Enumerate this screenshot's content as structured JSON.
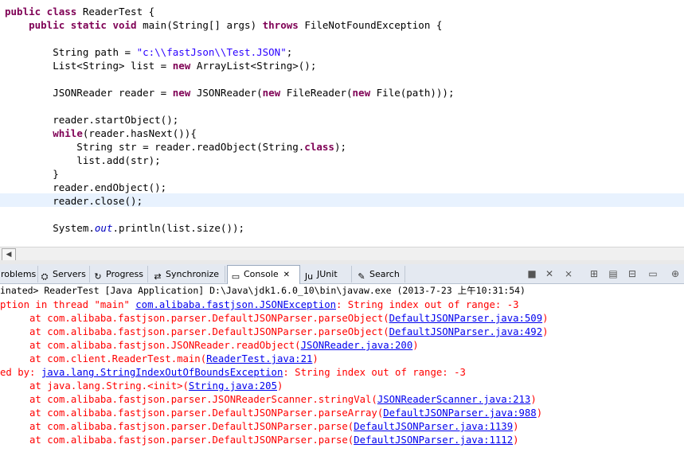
{
  "editor": {
    "lines": [
      [
        "kw:public class ",
        "t:ReaderTest {"
      ],
      [
        "t:    ",
        "kw:public static void ",
        "t:main(String[] args) ",
        "kw:throws ",
        "t:FileNotFoundException {"
      ],
      [
        "t:"
      ],
      [
        "t:        String path = ",
        "s:\"c:\\\\fastJson\\\\Test.JSON\"",
        "t:;"
      ],
      [
        "t:        List<String> list = ",
        "kw:new ",
        "t:ArrayList<String>();"
      ],
      [
        "t:"
      ],
      [
        "t:        JSONReader reader = ",
        "kw:new ",
        "t:JSONReader(",
        "kw:new ",
        "t:FileReader(",
        "kw:new ",
        "t:File(path)));"
      ],
      [
        "t:"
      ],
      [
        "t:        reader.startObject();"
      ],
      [
        "t:        ",
        "kw:while",
        "t:(reader.hasNext()){"
      ],
      [
        "t:            String str = reader.readObject(String.",
        "kw:class",
        "t:);"
      ],
      [
        "t:            list.add(str);"
      ],
      [
        "t:        }"
      ],
      [
        "t:        reader.endObject();"
      ],
      [
        "t:        reader.close();"
      ],
      [
        "t:"
      ],
      [
        "t:        System.",
        "f:out",
        "t:.println(list.size());"
      ]
    ]
  },
  "tabs": [
    {
      "label": "roblems",
      "icon": "problems-icon",
      "glyph": ""
    },
    {
      "label": "Servers",
      "icon": "servers-icon",
      "glyph": "⛭"
    },
    {
      "label": "Progress",
      "icon": "progress-icon",
      "glyph": "↻"
    },
    {
      "label": "Synchronize",
      "icon": "synchronize-icon",
      "glyph": "⇄"
    },
    {
      "label": "Console",
      "icon": "console-icon",
      "glyph": "▭",
      "close": "✕"
    },
    {
      "label": "JUnit",
      "icon": "junit-icon",
      "glyph": "Ju"
    },
    {
      "label": "Search",
      "icon": "search-icon",
      "glyph": "✎"
    }
  ],
  "infobar": {
    "text": "inated> ReaderTest [Java Application] D:\\Java\\jdk1.6.0_10\\bin\\javaw.exe (2013-7-23 上午10:31:54)"
  },
  "console": {
    "lines": [
      [
        "t:ption in thread \"main\" ",
        "l:com.alibaba.fastjson.JSONException",
        "t:: String index out of range: -3"
      ],
      [
        "t:     at com.alibaba.fastjson.parser.DefaultJSONParser.parseObject(",
        "l:DefaultJSONParser.java:509",
        "t:)"
      ],
      [
        "t:     at com.alibaba.fastjson.parser.DefaultJSONParser.parseObject(",
        "l:DefaultJSONParser.java:492",
        "t:)"
      ],
      [
        "t:     at com.alibaba.fastjson.JSONReader.readObject(",
        "l:JSONReader.java:200",
        "t:)"
      ],
      [
        "t:     at com.client.ReaderTest.main(",
        "l:ReaderTest.java:21",
        "t:)"
      ],
      [
        "t:ed by: ",
        "l:java.lang.StringIndexOutOfBoundsException",
        "t:: String index out of range: -3"
      ],
      [
        "t:     at java.lang.String.<init>(",
        "l:String.java:205",
        "t:)"
      ],
      [
        "t:     at com.alibaba.fastjson.parser.JSONReaderScanner.stringVal(",
        "l:JSONReaderScanner.java:213",
        "t:)"
      ],
      [
        "t:     at com.alibaba.fastjson.parser.DefaultJSONParser.parseArray(",
        "l:DefaultJSONParser.java:988",
        "t:)"
      ],
      [
        "t:     at com.alibaba.fastjson.parser.DefaultJSONParser.parse(",
        "l:DefaultJSONParser.java:1139",
        "t:)"
      ],
      [
        "t:     at com.alibaba.fastjson.parser.DefaultJSONParser.parse(",
        "l:DefaultJSONParser.java:1112",
        "t:)"
      ]
    ]
  },
  "toolbar_icons": [
    "terminate-icon",
    "remove-launch-icon",
    "remove-all-terminated-icon",
    "scroll-lock-icon",
    "show-console-icon",
    "pin-console-icon",
    "display-selected-console-icon",
    "open-console-icon"
  ]
}
